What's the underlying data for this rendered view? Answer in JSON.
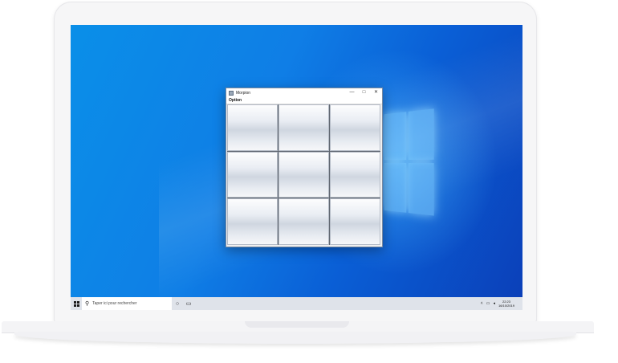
{
  "window": {
    "title": "Morpion",
    "minimize_glyph": "—",
    "maximize_glyph": "□",
    "close_glyph": "✕"
  },
  "menu": {
    "option_label": "Option"
  },
  "board": {
    "cells": [
      "",
      "",
      "",
      "",
      "",
      "",
      "",
      "",
      ""
    ]
  },
  "taskbar": {
    "search_placeholder": "Taper ici pour rechercher",
    "search_icon": "⚲",
    "cortana_icon": "○",
    "taskview_icon": "▭",
    "tray_up_icon": "˄",
    "network_icon": "▭",
    "volume_icon": "◂",
    "time": "22:23",
    "date": "16/10/2019"
  },
  "colors": {
    "desktop": "#0f7ee6",
    "taskbar": "#dfe3ea",
    "window_border": "#7a8aa0"
  }
}
